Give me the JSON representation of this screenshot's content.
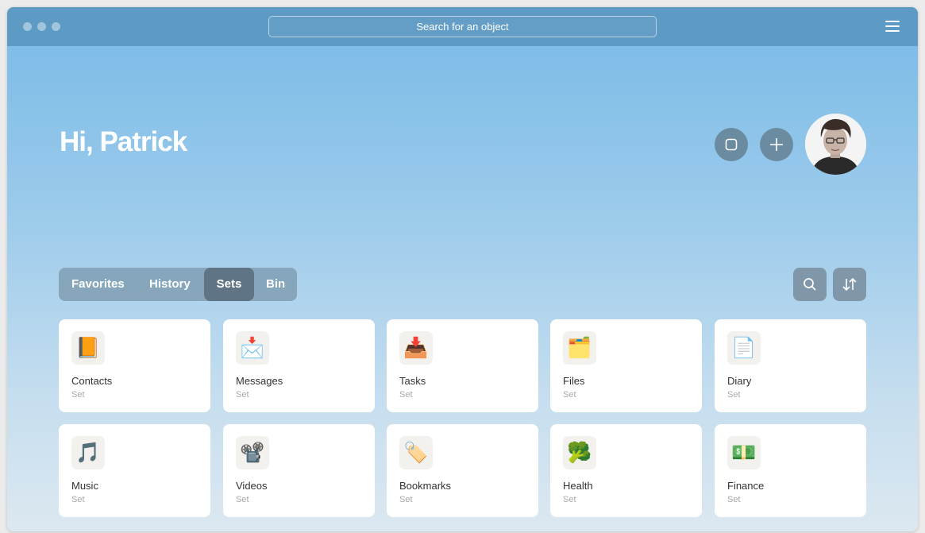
{
  "titlebar": {
    "search_placeholder": "Search for an object"
  },
  "header": {
    "greeting": "Hi, Patrick"
  },
  "tabs": [
    {
      "label": "Favorites",
      "active": false
    },
    {
      "label": "History",
      "active": false
    },
    {
      "label": "Sets",
      "active": true
    },
    {
      "label": "Bin",
      "active": false
    }
  ],
  "sets": [
    {
      "name": "Contacts",
      "type": "Set",
      "icon": "📙",
      "icon_name": "orange-book-icon"
    },
    {
      "name": "Messages",
      "type": "Set",
      "icon": "📩",
      "icon_name": "envelope-arrow-icon"
    },
    {
      "name": "Tasks",
      "type": "Set",
      "icon": "📥",
      "icon_name": "inbox-tray-icon"
    },
    {
      "name": "Files",
      "type": "Set",
      "icon": "🗂️",
      "icon_name": "card-index-dividers-icon"
    },
    {
      "name": "Diary",
      "type": "Set",
      "icon": "📄",
      "icon_name": "page-icon"
    },
    {
      "name": "Music",
      "type": "Set",
      "icon": "🎵",
      "icon_name": "musical-note-icon"
    },
    {
      "name": "Videos",
      "type": "Set",
      "icon": "📽️",
      "icon_name": "film-projector-icon"
    },
    {
      "name": "Bookmarks",
      "type": "Set",
      "icon": "🏷️",
      "icon_name": "label-tag-icon"
    },
    {
      "name": "Health",
      "type": "Set",
      "icon": "🥦",
      "icon_name": "broccoli-icon"
    },
    {
      "name": "Finance",
      "type": "Set",
      "icon": "💵",
      "icon_name": "dollar-banknote-icon"
    }
  ],
  "colors": {
    "titlebar": "#5e9bc4",
    "gradient_top": "#78b9e6",
    "gradient_bottom": "#dce8f0",
    "active_tab": "#5f7586"
  }
}
